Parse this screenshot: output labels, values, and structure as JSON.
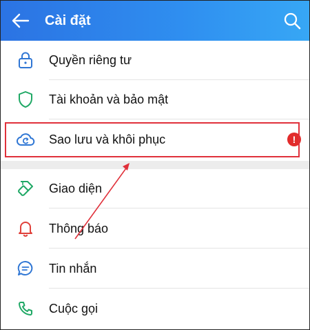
{
  "header": {
    "title": "Cài đặt",
    "back_icon": "arrow-left-icon",
    "search_icon": "search-icon"
  },
  "settings": {
    "items": [
      {
        "label": "Quyền riêng tư",
        "icon": "lock-icon"
      },
      {
        "label": "Tài khoản và bảo mật",
        "icon": "shield-icon"
      },
      {
        "label": "Sao lưu và khôi phục",
        "icon": "cloud-sync-icon",
        "alert": "!"
      },
      {
        "label": "Giao diện",
        "icon": "paint-brush-icon"
      },
      {
        "label": "Thông báo",
        "icon": "bell-icon"
      },
      {
        "label": "Tin nhắn",
        "icon": "chat-bubble-icon"
      },
      {
        "label": "Cuộc gọi",
        "icon": "phone-icon"
      }
    ]
  },
  "colors": {
    "header_start": "#2b73e3",
    "header_end": "#37a7f5",
    "highlight": "#e0303a",
    "icon_green": "#1fa865",
    "icon_blue": "#2f76d4",
    "icon_red": "#e0403a",
    "section_gap": "#ececec"
  }
}
